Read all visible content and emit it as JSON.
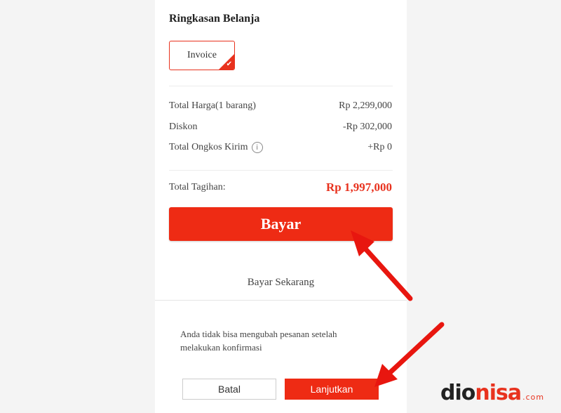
{
  "summary": {
    "title": "Ringkasan Belanja",
    "invoice_label": "Invoice",
    "rows": [
      {
        "label": "Total Harga(1 barang)",
        "value": "Rp 2,299,000"
      },
      {
        "label": "Diskon",
        "value": "-Rp 302,000"
      },
      {
        "label": "Total Ongkos Kirim",
        "value": "+Rp 0"
      }
    ],
    "info_icon": "i",
    "total_label": "Total Tagihan:",
    "total_value": "Rp 1,997,000",
    "pay_button": "Bayar",
    "pay_now": "Bayar Sekarang"
  },
  "confirm": {
    "notice": "Anda tidak bisa mengubah pesanan setelah melakukan konfirmasi",
    "cancel_button": "Batal",
    "continue_button": "Lanjutkan"
  },
  "watermark": {
    "part1": "dio",
    "part2": "nisa",
    "tld": ".com"
  },
  "colors": {
    "accent": "#ee2b14",
    "arrow": "#e8160f"
  },
  "icons": {
    "check": "check-icon",
    "info": "info-icon",
    "arrow": "annotation-arrow"
  }
}
